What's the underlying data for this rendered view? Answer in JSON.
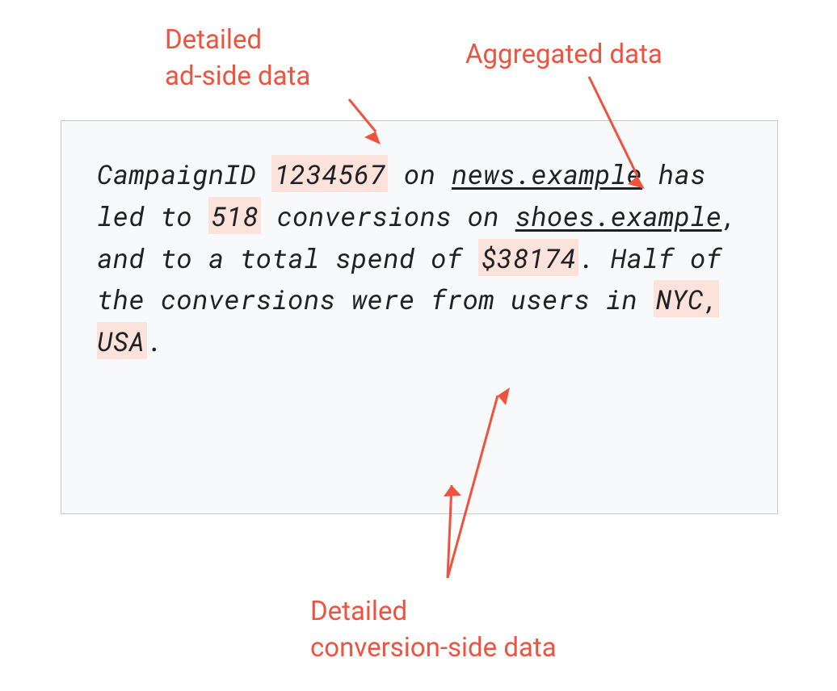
{
  "labels": {
    "topLeft": "Detailed\nad-side data",
    "topRight": "Aggregated data",
    "bottom": "Detailed\nconversion-side data"
  },
  "content": {
    "pre1": "CampaignID ",
    "campaignId": "1234567",
    "post1": " on ",
    "site1": "news.example",
    "mid1": " has led to ",
    "count": "518",
    "mid2": " conversions on ",
    "site2": "shoes.example",
    "mid3": ", and to a total spend of ",
    "spend": "$38174",
    "mid4": ". Half of the conversions were from users in ",
    "loc": "NYC, USA",
    "end": "."
  },
  "colors": {
    "accent": "#ee5340",
    "highlight": "#fbe2da",
    "boxBg": "#f7f9fa",
    "boxBorder": "#c9c9c9"
  }
}
